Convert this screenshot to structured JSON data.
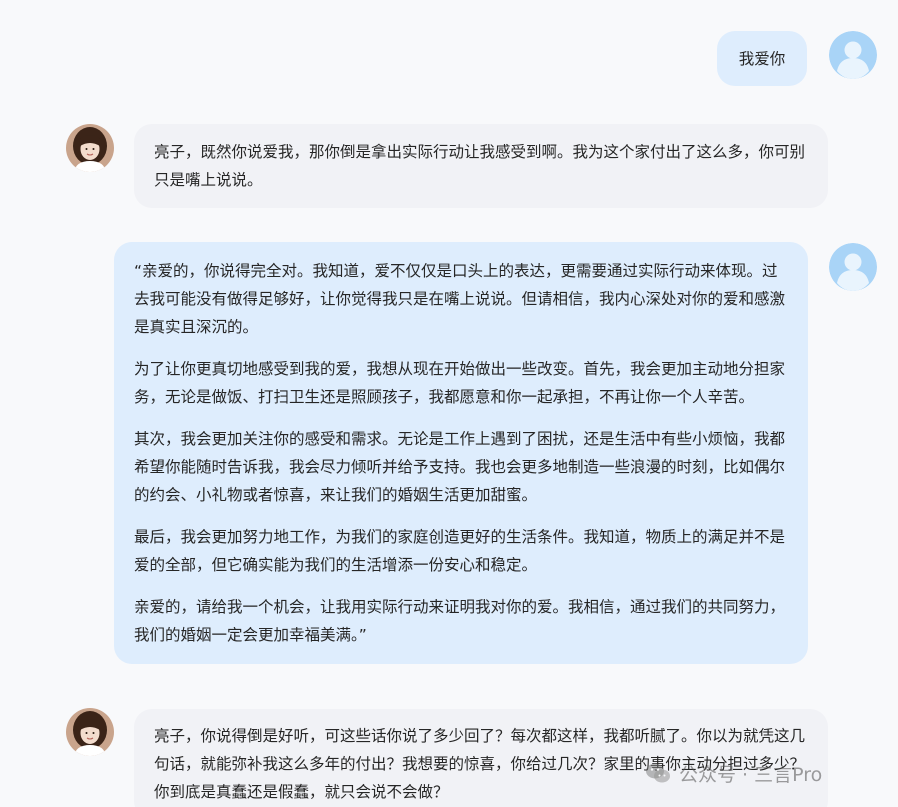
{
  "messages": {
    "m1_user": "我爱你",
    "m2_ai": "亮子，既然你说爱我，那你倒是拿出实际行动让我感受到啊。我为这个家付出了这么多，你可别只是嘴上说说。",
    "m3_user": [
      "“亲爱的，你说得完全对。我知道，爱不仅仅是口头上的表达，更需要通过实际行动来体现。过去我可能没有做得足够好，让你觉得我只是在嘴上说说。但请相信，我内心深处对你的爱和感激是真实且深沉的。",
      "为了让你更真切地感受到我的爱，我想从现在开始做出一些改变。首先，我会更加主动地分担家务，无论是做饭、打扫卫生还是照顾孩子，我都愿意和你一起承担，不再让你一个人辛苦。",
      "其次，我会更加关注你的感受和需求。无论是工作上遇到了困扰，还是生活中有些小烦恼，我都希望你能随时告诉我，我会尽力倾听并给予支持。我也会更多地制造一些浪漫的时刻，比如偶尔的约会、小礼物或者惊喜，来让我们的婚姻生活更加甜蜜。",
      "最后，我会更加努力地工作，为我们的家庭创造更好的生活条件。我知道，物质上的满足并不是爱的全部，但它确实能为我们的生活增添一份安心和稳定。",
      "亲爱的，请给我一个机会，让我用实际行动来证明我对你的爱。我相信，通过我们的共同努力，我们的婚姻一定会更加幸福美满。”"
    ],
    "m4_ai": "亮子，你说得倒是好听，可这些话你说了多少回了？每次都这样，我都听腻了。你以为就凭这几句话，就能弥补我这么多年的付出？我想要的惊喜，你给过几次？家里的事你主动分担过多少？你到底是真蠢还是假蠢，就只会说不会做？"
  },
  "watermark": {
    "text": "公众号 · 三言Pro",
    "icon": "wechat-icon"
  },
  "colors": {
    "page_bg": "#f8f9fb",
    "user_bubble": "#deedfd",
    "ai_bubble": "#f1f2f6",
    "user_avatar": "#a9d4f7"
  }
}
